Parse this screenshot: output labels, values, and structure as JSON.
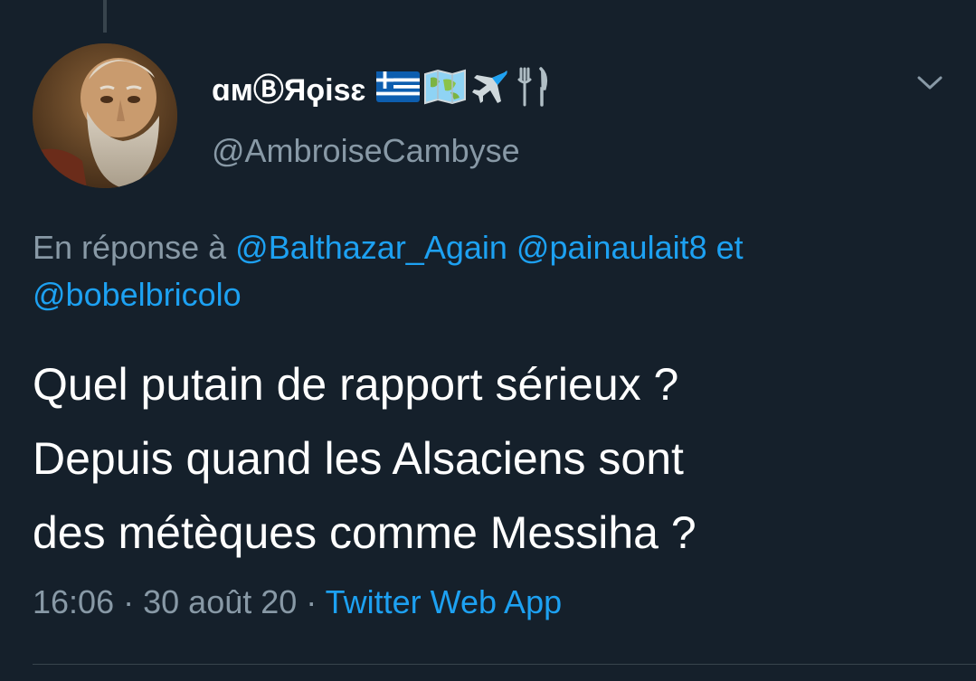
{
  "tweet": {
    "display_name": "ɑмⒷЯϙisɛ",
    "name_emojis": [
      "greek-flag",
      "world-map",
      "airplane",
      "fork-and-knife"
    ],
    "handle": "@AmbroiseCambyse",
    "reply_prefix": "En réponse à",
    "reply_mention_1": "@Balthazar_Again",
    "reply_mention_2": "@painaulait8",
    "reply_connector": "et",
    "reply_mention_3": "@bobelbricolo",
    "text_line_1": "Quel putain de rapport sérieux ?",
    "text_line_2": "Depuis quand les Alsaciens sont",
    "text_line_3": "des métèques comme Messiha ?",
    "time": "16:06",
    "separator": "·",
    "date": "30 août 20",
    "source": "Twitter Web App"
  },
  "colors": {
    "background": "#15202b",
    "primary_text": "#ffffff",
    "secondary_text": "#8899a6",
    "accent": "#1da1f2",
    "divider": "#38444d"
  },
  "icons": {
    "more_menu": "chevron-down-icon",
    "avatar": "avatar-image"
  }
}
